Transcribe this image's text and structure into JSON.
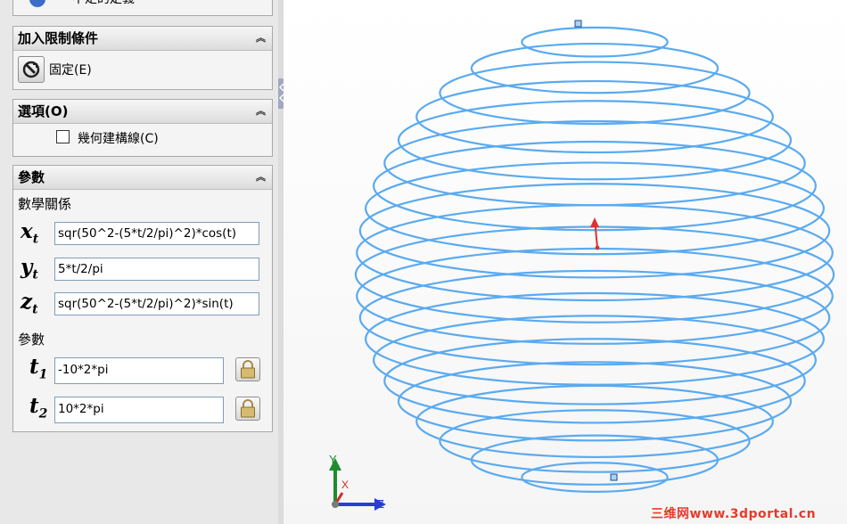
{
  "top_item": {
    "label": "不足的定義"
  },
  "constraints": {
    "title": "加入限制條件",
    "fix_label": "固定(E)"
  },
  "options": {
    "title": "選項(O)",
    "construction_label": "幾何建構線(C)",
    "construction_checked": false
  },
  "params": {
    "title": "參數",
    "equations_label": "數學關係",
    "x_label": "x",
    "x_sub": "t",
    "y_label": "y",
    "y_sub": "t",
    "z_label": "z",
    "z_sub": "t",
    "x_expr": "sqr(50^2-(5*t/2/pi)^2)*cos(t)",
    "y_expr": "5*t/2/pi",
    "z_expr": "sqr(50^2-(5*t/2/pi)^2)*sin(t)",
    "parameters_label": "參數",
    "t1_label": "t",
    "t1_sub": "1",
    "t2_label": "t",
    "t2_sub": "2",
    "t1_value": "-10*2*pi",
    "t2_value": "10*2*pi"
  },
  "triad": {
    "y": "Y",
    "x": "X",
    "z": "Z"
  },
  "watermark": "三维网www.3dportal.cn",
  "colors": {
    "curve": "#5aaaf0",
    "triad_x": "#d42a2a",
    "triad_y": "#1e8c2e",
    "triad_z": "#2a3fd2",
    "handle": "#e03030",
    "watermark": "#e53b2b"
  }
}
